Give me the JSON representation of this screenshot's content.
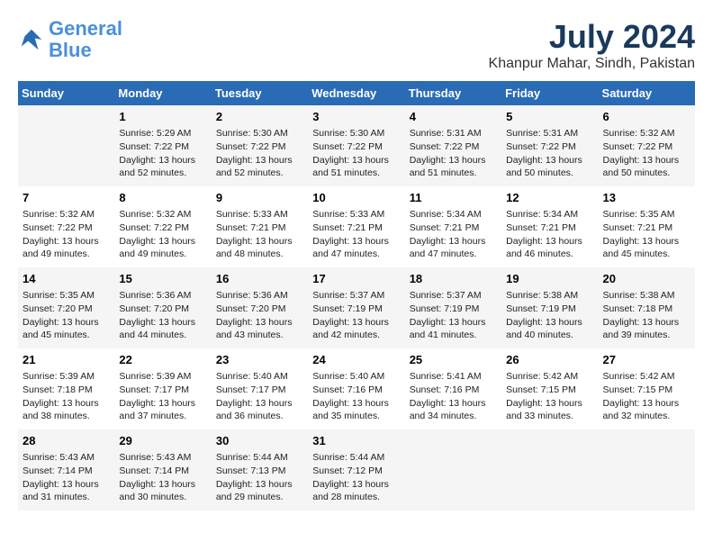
{
  "header": {
    "logo_line1": "General",
    "logo_line2": "Blue",
    "month_year": "July 2024",
    "location": "Khanpur Mahar, Sindh, Pakistan"
  },
  "days_of_week": [
    "Sunday",
    "Monday",
    "Tuesday",
    "Wednesday",
    "Thursday",
    "Friday",
    "Saturday"
  ],
  "weeks": [
    [
      {
        "day": "",
        "info": ""
      },
      {
        "day": "1",
        "info": "Sunrise: 5:29 AM\nSunset: 7:22 PM\nDaylight: 13 hours\nand 52 minutes."
      },
      {
        "day": "2",
        "info": "Sunrise: 5:30 AM\nSunset: 7:22 PM\nDaylight: 13 hours\nand 52 minutes."
      },
      {
        "day": "3",
        "info": "Sunrise: 5:30 AM\nSunset: 7:22 PM\nDaylight: 13 hours\nand 51 minutes."
      },
      {
        "day": "4",
        "info": "Sunrise: 5:31 AM\nSunset: 7:22 PM\nDaylight: 13 hours\nand 51 minutes."
      },
      {
        "day": "5",
        "info": "Sunrise: 5:31 AM\nSunset: 7:22 PM\nDaylight: 13 hours\nand 50 minutes."
      },
      {
        "day": "6",
        "info": "Sunrise: 5:32 AM\nSunset: 7:22 PM\nDaylight: 13 hours\nand 50 minutes."
      }
    ],
    [
      {
        "day": "7",
        "info": "Sunrise: 5:32 AM\nSunset: 7:22 PM\nDaylight: 13 hours\nand 49 minutes."
      },
      {
        "day": "8",
        "info": "Sunrise: 5:32 AM\nSunset: 7:22 PM\nDaylight: 13 hours\nand 49 minutes."
      },
      {
        "day": "9",
        "info": "Sunrise: 5:33 AM\nSunset: 7:21 PM\nDaylight: 13 hours\nand 48 minutes."
      },
      {
        "day": "10",
        "info": "Sunrise: 5:33 AM\nSunset: 7:21 PM\nDaylight: 13 hours\nand 47 minutes."
      },
      {
        "day": "11",
        "info": "Sunrise: 5:34 AM\nSunset: 7:21 PM\nDaylight: 13 hours\nand 47 minutes."
      },
      {
        "day": "12",
        "info": "Sunrise: 5:34 AM\nSunset: 7:21 PM\nDaylight: 13 hours\nand 46 minutes."
      },
      {
        "day": "13",
        "info": "Sunrise: 5:35 AM\nSunset: 7:21 PM\nDaylight: 13 hours\nand 45 minutes."
      }
    ],
    [
      {
        "day": "14",
        "info": "Sunrise: 5:35 AM\nSunset: 7:20 PM\nDaylight: 13 hours\nand 45 minutes."
      },
      {
        "day": "15",
        "info": "Sunrise: 5:36 AM\nSunset: 7:20 PM\nDaylight: 13 hours\nand 44 minutes."
      },
      {
        "day": "16",
        "info": "Sunrise: 5:36 AM\nSunset: 7:20 PM\nDaylight: 13 hours\nand 43 minutes."
      },
      {
        "day": "17",
        "info": "Sunrise: 5:37 AM\nSunset: 7:19 PM\nDaylight: 13 hours\nand 42 minutes."
      },
      {
        "day": "18",
        "info": "Sunrise: 5:37 AM\nSunset: 7:19 PM\nDaylight: 13 hours\nand 41 minutes."
      },
      {
        "day": "19",
        "info": "Sunrise: 5:38 AM\nSunset: 7:19 PM\nDaylight: 13 hours\nand 40 minutes."
      },
      {
        "day": "20",
        "info": "Sunrise: 5:38 AM\nSunset: 7:18 PM\nDaylight: 13 hours\nand 39 minutes."
      }
    ],
    [
      {
        "day": "21",
        "info": "Sunrise: 5:39 AM\nSunset: 7:18 PM\nDaylight: 13 hours\nand 38 minutes."
      },
      {
        "day": "22",
        "info": "Sunrise: 5:39 AM\nSunset: 7:17 PM\nDaylight: 13 hours\nand 37 minutes."
      },
      {
        "day": "23",
        "info": "Sunrise: 5:40 AM\nSunset: 7:17 PM\nDaylight: 13 hours\nand 36 minutes."
      },
      {
        "day": "24",
        "info": "Sunrise: 5:40 AM\nSunset: 7:16 PM\nDaylight: 13 hours\nand 35 minutes."
      },
      {
        "day": "25",
        "info": "Sunrise: 5:41 AM\nSunset: 7:16 PM\nDaylight: 13 hours\nand 34 minutes."
      },
      {
        "day": "26",
        "info": "Sunrise: 5:42 AM\nSunset: 7:15 PM\nDaylight: 13 hours\nand 33 minutes."
      },
      {
        "day": "27",
        "info": "Sunrise: 5:42 AM\nSunset: 7:15 PM\nDaylight: 13 hours\nand 32 minutes."
      }
    ],
    [
      {
        "day": "28",
        "info": "Sunrise: 5:43 AM\nSunset: 7:14 PM\nDaylight: 13 hours\nand 31 minutes."
      },
      {
        "day": "29",
        "info": "Sunrise: 5:43 AM\nSunset: 7:14 PM\nDaylight: 13 hours\nand 30 minutes."
      },
      {
        "day": "30",
        "info": "Sunrise: 5:44 AM\nSunset: 7:13 PM\nDaylight: 13 hours\nand 29 minutes."
      },
      {
        "day": "31",
        "info": "Sunrise: 5:44 AM\nSunset: 7:12 PM\nDaylight: 13 hours\nand 28 minutes."
      },
      {
        "day": "",
        "info": ""
      },
      {
        "day": "",
        "info": ""
      },
      {
        "day": "",
        "info": ""
      }
    ]
  ]
}
